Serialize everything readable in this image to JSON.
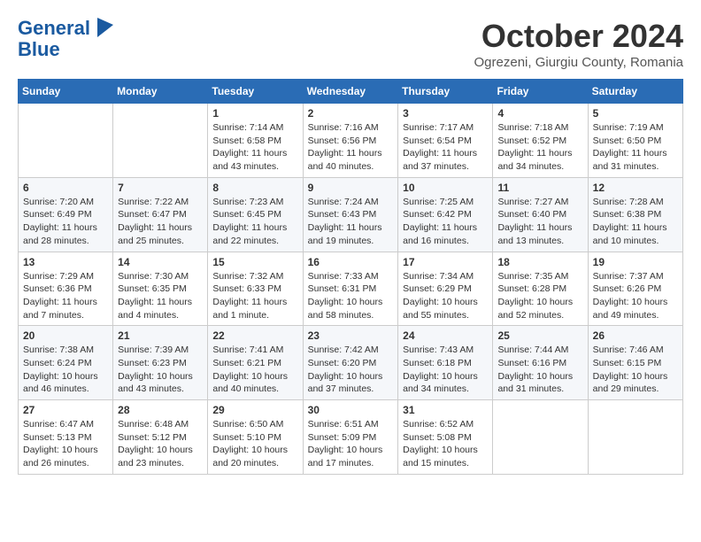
{
  "header": {
    "logo_line1": "General",
    "logo_line2": "Blue",
    "month": "October 2024",
    "location": "Ogrezeni, Giurgiu County, Romania"
  },
  "weekdays": [
    "Sunday",
    "Monday",
    "Tuesday",
    "Wednesday",
    "Thursday",
    "Friday",
    "Saturday"
  ],
  "weeks": [
    [
      {
        "day": "",
        "info": ""
      },
      {
        "day": "",
        "info": ""
      },
      {
        "day": "1",
        "info": "Sunrise: 7:14 AM\nSunset: 6:58 PM\nDaylight: 11 hours and 43 minutes."
      },
      {
        "day": "2",
        "info": "Sunrise: 7:16 AM\nSunset: 6:56 PM\nDaylight: 11 hours and 40 minutes."
      },
      {
        "day": "3",
        "info": "Sunrise: 7:17 AM\nSunset: 6:54 PM\nDaylight: 11 hours and 37 minutes."
      },
      {
        "day": "4",
        "info": "Sunrise: 7:18 AM\nSunset: 6:52 PM\nDaylight: 11 hours and 34 minutes."
      },
      {
        "day": "5",
        "info": "Sunrise: 7:19 AM\nSunset: 6:50 PM\nDaylight: 11 hours and 31 minutes."
      }
    ],
    [
      {
        "day": "6",
        "info": "Sunrise: 7:20 AM\nSunset: 6:49 PM\nDaylight: 11 hours and 28 minutes."
      },
      {
        "day": "7",
        "info": "Sunrise: 7:22 AM\nSunset: 6:47 PM\nDaylight: 11 hours and 25 minutes."
      },
      {
        "day": "8",
        "info": "Sunrise: 7:23 AM\nSunset: 6:45 PM\nDaylight: 11 hours and 22 minutes."
      },
      {
        "day": "9",
        "info": "Sunrise: 7:24 AM\nSunset: 6:43 PM\nDaylight: 11 hours and 19 minutes."
      },
      {
        "day": "10",
        "info": "Sunrise: 7:25 AM\nSunset: 6:42 PM\nDaylight: 11 hours and 16 minutes."
      },
      {
        "day": "11",
        "info": "Sunrise: 7:27 AM\nSunset: 6:40 PM\nDaylight: 11 hours and 13 minutes."
      },
      {
        "day": "12",
        "info": "Sunrise: 7:28 AM\nSunset: 6:38 PM\nDaylight: 11 hours and 10 minutes."
      }
    ],
    [
      {
        "day": "13",
        "info": "Sunrise: 7:29 AM\nSunset: 6:36 PM\nDaylight: 11 hours and 7 minutes."
      },
      {
        "day": "14",
        "info": "Sunrise: 7:30 AM\nSunset: 6:35 PM\nDaylight: 11 hours and 4 minutes."
      },
      {
        "day": "15",
        "info": "Sunrise: 7:32 AM\nSunset: 6:33 PM\nDaylight: 11 hours and 1 minute."
      },
      {
        "day": "16",
        "info": "Sunrise: 7:33 AM\nSunset: 6:31 PM\nDaylight: 10 hours and 58 minutes."
      },
      {
        "day": "17",
        "info": "Sunrise: 7:34 AM\nSunset: 6:29 PM\nDaylight: 10 hours and 55 minutes."
      },
      {
        "day": "18",
        "info": "Sunrise: 7:35 AM\nSunset: 6:28 PM\nDaylight: 10 hours and 52 minutes."
      },
      {
        "day": "19",
        "info": "Sunrise: 7:37 AM\nSunset: 6:26 PM\nDaylight: 10 hours and 49 minutes."
      }
    ],
    [
      {
        "day": "20",
        "info": "Sunrise: 7:38 AM\nSunset: 6:24 PM\nDaylight: 10 hours and 46 minutes."
      },
      {
        "day": "21",
        "info": "Sunrise: 7:39 AM\nSunset: 6:23 PM\nDaylight: 10 hours and 43 minutes."
      },
      {
        "day": "22",
        "info": "Sunrise: 7:41 AM\nSunset: 6:21 PM\nDaylight: 10 hours and 40 minutes."
      },
      {
        "day": "23",
        "info": "Sunrise: 7:42 AM\nSunset: 6:20 PM\nDaylight: 10 hours and 37 minutes."
      },
      {
        "day": "24",
        "info": "Sunrise: 7:43 AM\nSunset: 6:18 PM\nDaylight: 10 hours and 34 minutes."
      },
      {
        "day": "25",
        "info": "Sunrise: 7:44 AM\nSunset: 6:16 PM\nDaylight: 10 hours and 31 minutes."
      },
      {
        "day": "26",
        "info": "Sunrise: 7:46 AM\nSunset: 6:15 PM\nDaylight: 10 hours and 29 minutes."
      }
    ],
    [
      {
        "day": "27",
        "info": "Sunrise: 6:47 AM\nSunset: 5:13 PM\nDaylight: 10 hours and 26 minutes."
      },
      {
        "day": "28",
        "info": "Sunrise: 6:48 AM\nSunset: 5:12 PM\nDaylight: 10 hours and 23 minutes."
      },
      {
        "day": "29",
        "info": "Sunrise: 6:50 AM\nSunset: 5:10 PM\nDaylight: 10 hours and 20 minutes."
      },
      {
        "day": "30",
        "info": "Sunrise: 6:51 AM\nSunset: 5:09 PM\nDaylight: 10 hours and 17 minutes."
      },
      {
        "day": "31",
        "info": "Sunrise: 6:52 AM\nSunset: 5:08 PM\nDaylight: 10 hours and 15 minutes."
      },
      {
        "day": "",
        "info": ""
      },
      {
        "day": "",
        "info": ""
      }
    ]
  ]
}
